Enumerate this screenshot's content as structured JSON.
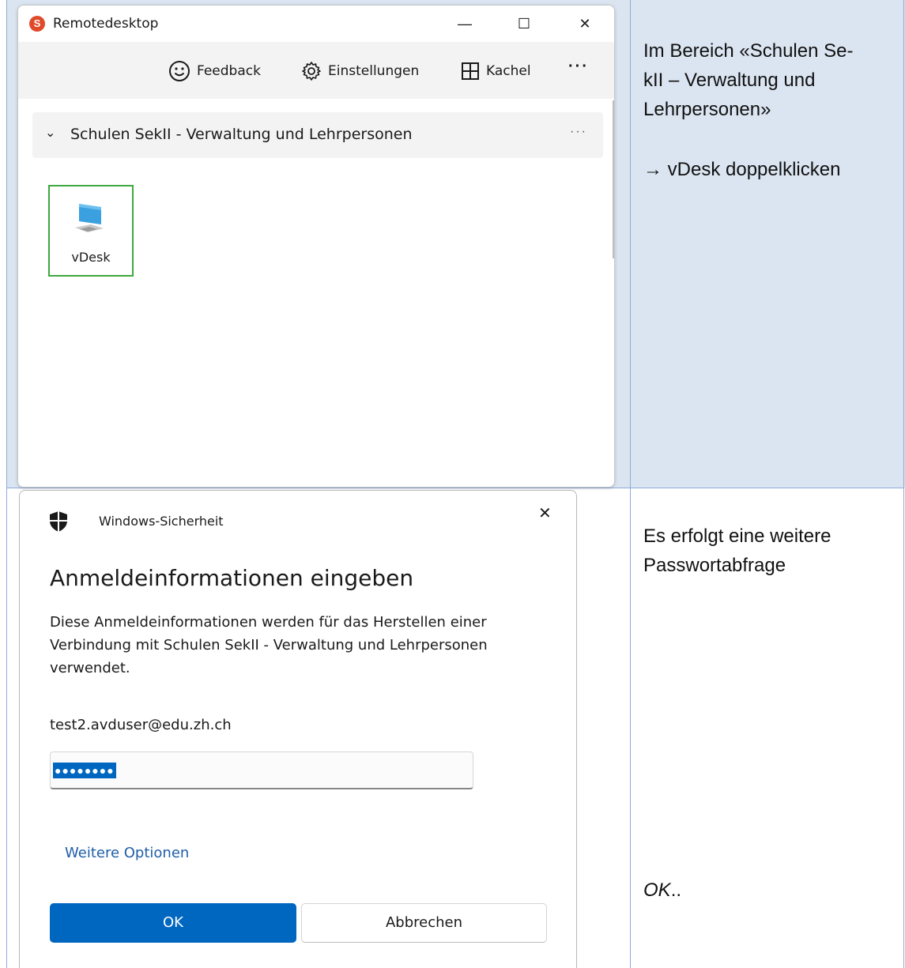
{
  "remote_desktop": {
    "title": "Remotedesktop",
    "logo_glyph": "S",
    "window_controls": {
      "minimize": "—",
      "maximize": "☐",
      "close": "✕"
    },
    "toolbar": {
      "feedback": "Feedback",
      "settings": "Einstellungen",
      "view": "Kachel",
      "more": "···"
    },
    "group": {
      "title": "Schulen SekII - Verwaltung und Lehrpersonen",
      "more": "···"
    },
    "tile": {
      "label": "vDesk",
      "icon": "computer-monitor-icon"
    }
  },
  "notes": {
    "step1_line1": "Im Bereich «Schulen Se-",
    "step1_line2": "kII – Verwaltung und",
    "step1_line3": "Lehrpersonen»",
    "step1_action": "→ vDesk doppelklicken",
    "step2_line1": "Es erfolgt eine weitere",
    "step2_line2": "Passwortabfrage",
    "step3": "OK",
    "step3_suffix": ".."
  },
  "security_dialog": {
    "app_name": "Windows-Sicherheit",
    "close": "✕",
    "heading": "Anmeldeinformationen eingeben",
    "description": "Diese Anmeldeinformationen werden für das Herstellen einer Verbindung mit Schulen SekII - Verwaltung und Lehrpersonen verwendet.",
    "username": "test2.avduser@edu.zh.ch",
    "password_masked": "●●●●●●●●",
    "more_options": "Weitere Optionen",
    "ok": "OK",
    "cancel": "Abbrechen"
  },
  "colors": {
    "accent": "#0067c0",
    "table_shade": "#dbe5f1",
    "table_border": "#8eaadb",
    "tile_border": "#3ea83e"
  }
}
